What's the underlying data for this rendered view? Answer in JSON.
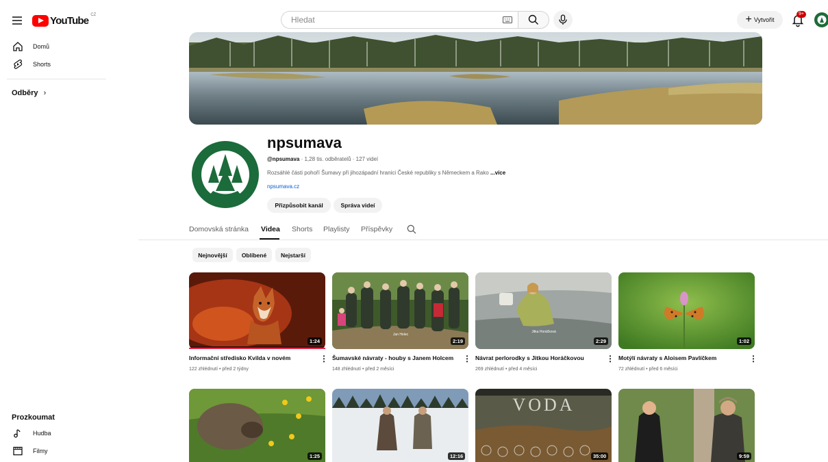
{
  "topbar": {
    "logo_text": "YouTube",
    "logo_country": "CZ",
    "search_placeholder": "Hledat",
    "create_label": "Vytvořit",
    "notifications_badge": "9+"
  },
  "sidebar": {
    "items": [
      {
        "label": "Domů",
        "icon": "home-icon"
      },
      {
        "label": "Shorts",
        "icon": "shorts-icon"
      }
    ],
    "subscriptions_label": "Odběry",
    "explore_label": "Prozkoumat",
    "explore_items": [
      {
        "label": "Hudba",
        "icon": "music-icon"
      },
      {
        "label": "Filmy",
        "icon": "film-icon"
      }
    ]
  },
  "channel": {
    "name": "npsumava",
    "handle": "@npsumava",
    "meta": " · 1,28 tis. odběratelů · 127 videí",
    "description": "Rozsáhlé části pohoří Šumavy při jihozápadní hranici České republiky s Německem a Rako",
    "more_label": "...více",
    "link": "npsumava.cz",
    "customize_label": "Přizpůsobit kanál",
    "manage_label": "Správa videí",
    "avatar_text": "NÁRODNÍ PARK · CHRÁNĚNÁ KRAJINNÁ OBLAST · ŠUMAVA"
  },
  "tabs": [
    {
      "label": "Domovská stránka"
    },
    {
      "label": "Videa"
    },
    {
      "label": "Shorts"
    },
    {
      "label": "Playlisty"
    },
    {
      "label": "Příspěvky"
    }
  ],
  "chips": [
    {
      "label": "Nejnovější"
    },
    {
      "label": "Oblíbené"
    },
    {
      "label": "Nejstarší"
    }
  ],
  "videos": [
    {
      "title": "Informační středisko Kvilda v novém",
      "meta": "122 zhlédnutí • před 2 týdny",
      "duration": "1:24",
      "caption": ""
    },
    {
      "title": "Šumavské návraty - houby s Janem Holcem",
      "meta": "148 zhlédnutí • před 2 měsíci",
      "duration": "2:19",
      "caption": "Jan Holec"
    },
    {
      "title": "Návrat perlorodky s Jitkou Horáčkovou",
      "meta": "269 zhlédnutí • před 4 měsíci",
      "duration": "2:29",
      "caption": "Jitka Horáčková"
    },
    {
      "title": "Motýlí návraty s Aloisem Pavlíčkem",
      "meta": "72 zhlédnutí • před 6 měsíci",
      "duration": "1:02",
      "caption": ""
    },
    {
      "title": "",
      "meta": "",
      "duration": "1:25",
      "caption": ""
    },
    {
      "title": "",
      "meta": "",
      "duration": "12:16",
      "caption": ""
    },
    {
      "title": "",
      "meta": "",
      "duration": "35:00",
      "caption": "VODA"
    },
    {
      "title": "",
      "meta": "",
      "duration": "9:59",
      "caption": ""
    }
  ]
}
